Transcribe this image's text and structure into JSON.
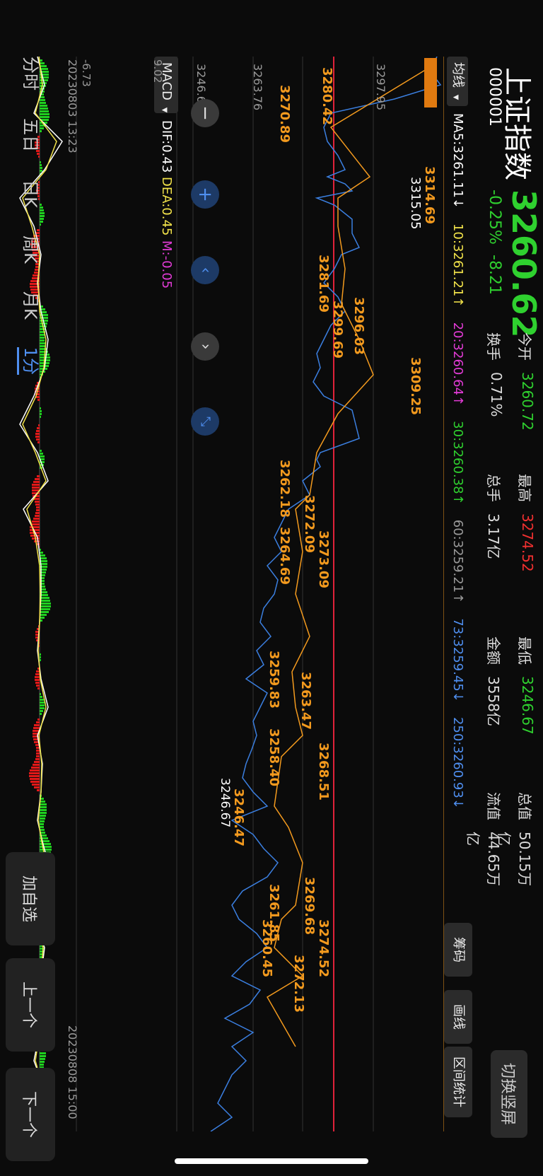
{
  "header": {
    "name": "上证指数",
    "code": "000001",
    "price": "3260.62",
    "change_pct": "-0.25%",
    "change": "-8.21",
    "stats": [
      {
        "label": "今开",
        "value": "3260.72",
        "color": "#2fd12f"
      },
      {
        "label": "最高",
        "value": "3274.52",
        "color": "#f03030"
      },
      {
        "label": "最低",
        "value": "3246.67",
        "color": "#2fd12f"
      },
      {
        "label": "总值",
        "value": "50.15万亿",
        "color": "#dddddd"
      },
      {
        "label": "换手",
        "value": "0.71%",
        "color": "#dddddd"
      },
      {
        "label": "总手",
        "value": "3.17亿",
        "color": "#dddddd"
      },
      {
        "label": "金额",
        "value": "3558亿",
        "color": "#dddddd"
      },
      {
        "label": "流值",
        "value": "44.65万亿",
        "color": "#dddddd"
      }
    ],
    "switch_button": "切换竖屏"
  },
  "ma_bar": {
    "selector": "均线",
    "items": [
      {
        "text": "MA5:3261.11↓",
        "color": "#ffffff"
      },
      {
        "text": "10:3261.21↑",
        "color": "#f2e34a"
      },
      {
        "text": "20:3260.64↑",
        "color": "#e23bd6"
      },
      {
        "text": "30:3260.38↑",
        "color": "#2fd12f"
      },
      {
        "text": "60:3259.21↑",
        "color": "#9a9a9a"
      },
      {
        "text": "73:3259.45↓",
        "color": "#4f8ff0"
      },
      {
        "text": "250:3260.93↓",
        "color": "#4f8ff0"
      }
    ]
  },
  "side_buttons": [
    "筹码",
    "画线",
    "区间统计"
  ],
  "price_axis": [
    "3297.95",
    "3263.76",
    "3246.67"
  ],
  "date_start": "20230803 13:23",
  "date_end": "20230808 15:00",
  "macd": {
    "selector": "MACD",
    "dif": "DIF:0.43",
    "dea": "DEA:0.45",
    "m": "M:-0.05",
    "axis_top": "9.02",
    "axis_bottom": "-6.73"
  },
  "tabs": [
    "分时",
    "五日",
    "日K",
    "周K",
    "月K",
    "1分"
  ],
  "bottom_buttons": [
    "加自选",
    "上一个",
    "下一个"
  ],
  "annotations": [
    "3280.42",
    "3270.89",
    "3314.69",
    "3315.05",
    "3281.69",
    "3296.03",
    "3299.69",
    "3309.25",
    "3262.18",
    "3272.09",
    "3273.09",
    "3264.69",
    "3259.83",
    "3263.47",
    "3258.40",
    "3268.51",
    "3246.67",
    "3246.47",
    "3269.68",
    "3274.52",
    "3272.13",
    "3261.85",
    "3260.45"
  ],
  "colors": {
    "price_line": "#3b7fe0",
    "zigzag": "#f39a1e",
    "ref_line": "#e0223a",
    "macd_up": "#e01818",
    "macd_down": "#1fd01f"
  }
}
